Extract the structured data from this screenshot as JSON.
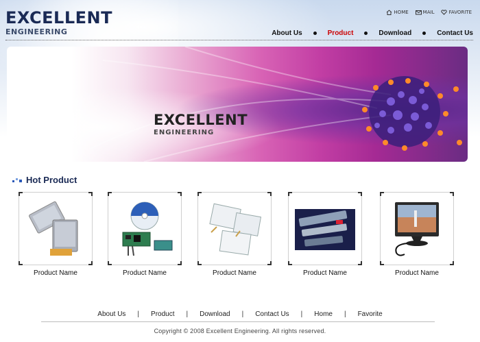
{
  "logo": {
    "line1": "EXCELLENT",
    "line2": "ENGINEERING"
  },
  "utility": [
    {
      "label": "HOME",
      "icon": "home-icon"
    },
    {
      "label": "MAIL",
      "icon": "mail-icon"
    },
    {
      "label": "FAVORITE",
      "icon": "heart-icon"
    }
  ],
  "nav": [
    {
      "label": "About Us"
    },
    {
      "label": "Product",
      "active": true
    },
    {
      "label": "Download"
    },
    {
      "label": "Contact Us"
    }
  ],
  "banner": {
    "title": "EXCELLENT",
    "subtitle": "ENGINEERING"
  },
  "hot_product": {
    "title": "Hot Product",
    "items": [
      {
        "name": "Product Name",
        "image": "lcd-display-panels"
      },
      {
        "name": "Product Name",
        "image": "cd-and-circuit-board"
      },
      {
        "name": "Product Name",
        "image": "touch-screen-panels"
      },
      {
        "name": "Product Name",
        "image": "electronic-modules"
      },
      {
        "name": "Product Name",
        "image": "lcd-monitor"
      }
    ]
  },
  "footer": {
    "links": [
      "About Us",
      "Product",
      "Download",
      "Contact Us",
      "Home",
      "Favorite"
    ],
    "copyright": "Copyright © 2008 Excellent Engineering. All rights reserved."
  },
  "colors": {
    "accent": "#cc0000",
    "brand": "#1a2a55",
    "banner": "#c23ea4"
  }
}
